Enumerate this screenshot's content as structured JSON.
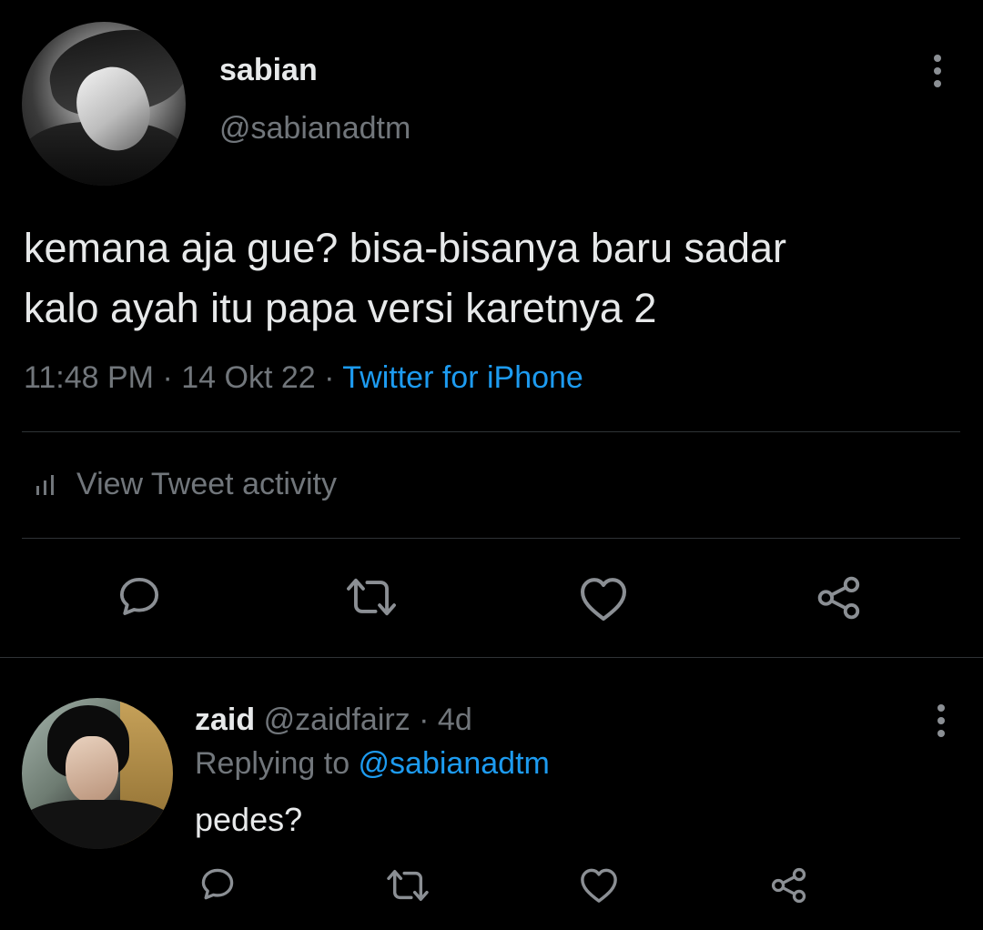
{
  "tweet": {
    "author_name": "sabian",
    "author_handle": "@sabianadtm",
    "text_line1": "kemana aja gue? bisa-bisanya baru sadar",
    "text_line2": "kalo ayah itu papa versi karetnya 2",
    "time": "11:48 PM",
    "sep": " · ",
    "date": "14 Okt 22",
    "source": "Twitter for iPhone",
    "activity_label": "View Tweet activity",
    "actions": [
      "reply-icon",
      "retweet-icon",
      "like-icon",
      "share-icon"
    ]
  },
  "reply": {
    "author_name": "zaid",
    "author_handle": "@zaidfairz",
    "age": "4d",
    "replying_prefix": "Replying to ",
    "replying_to": "@sabianadtm",
    "text": "pedes?",
    "actions": [
      "reply-icon",
      "retweet-icon",
      "like-icon",
      "share-icon"
    ]
  },
  "colors": {
    "background": "#000000",
    "primary_text": "#e7e9ea",
    "secondary_text": "#71767b",
    "link": "#1d9bf0",
    "divider": "#2f3336"
  }
}
